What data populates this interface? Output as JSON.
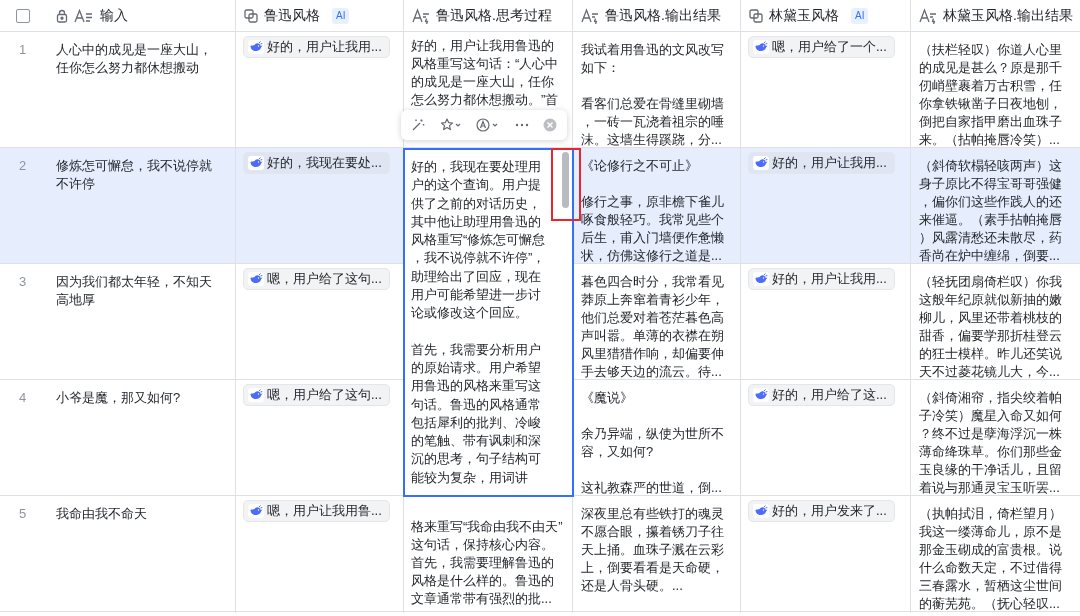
{
  "header_checkbox": {
    "checked": false
  },
  "columns": [
    {
      "kind": "text",
      "label": "输入"
    },
    {
      "kind": "ai",
      "label": "鲁迅风格",
      "badge": "AI"
    },
    {
      "kind": "derived",
      "label": "鲁迅风格.思考过程"
    },
    {
      "kind": "derived",
      "label": "鲁迅风格.输出结果"
    },
    {
      "kind": "ai",
      "label": "林黛玉风格",
      "badge": "AI"
    },
    {
      "kind": "derived",
      "label": "林黛玉风格.输出结果"
    }
  ],
  "rows": [
    {
      "number": "1",
      "selected": false,
      "thinking_editing": false,
      "input": "人心中的成见是一座大山，任你怎么努力都休想搬动",
      "luxun_chip": "好的，用户让我用...",
      "luxun_thinking": [
        "好的，用户让我用鲁迅的风格重写这句话：“人心中的成见是一座大山，任你怎么努力都休想搬动。”首"
      ],
      "luxun_output": [
        "我试着用鲁迅的文风改写如下：",
        "看客们总爱在骨缝里砌墙，一砖一瓦浇着祖宗的唾沫。这墙生得蹊跷，分..."
      ],
      "lin_chip": "嗯，用户给了一个...",
      "lin_output": "（扶栏轻叹）你道人心里的成见是甚么？原是那千仞峭壁裹着万古积雪，任你拿铁锹凿子日夜地刨，倒把自家指甲磨出血珠子来。（拈帕掩唇冷笑）..."
    },
    {
      "number": "2",
      "selected": true,
      "thinking_editing": true,
      "input": "修炼怎可懈怠，我不说停就不许停",
      "luxun_chip": "好的，我现在要处...",
      "luxun_thinking": [
        "好的，我现在要处理用户的这个查询。用户提供了之前的对话历史，其中他让助理用鲁迅的风格重写“修炼怎可懈怠，我不说停就不许停”，助理给出了回应，现在用户可能希望进一步讨论或修改这个回应。",
        "首先，我需要分析用户的原始请求。用户希望用鲁迅的风格来重写这句话。鲁迅的风格通常包括犀利的批判、冷峻的笔触、带有讽刺和深沉的思考，句子结构可能较为复杂，用词讲"
      ],
      "luxun_output": [
        "《论修行之不可止》",
        "修行之事，原非檐下雀儿啄食般轻巧。我常见些个后生，甫入门墙便作惫懒状，仿佛这修行之道是..."
      ],
      "lin_chip": "好的，用户让我用...",
      "lin_output": "（斜倚软榻轻咳两声）这身子原比不得宝哥哥强健，偏你们这些作践人的还来催逼。（素手拈帕掩唇）风露清愁还未散尽，药香尚在炉中缠绵，倒要..."
    },
    {
      "number": "3",
      "selected": false,
      "thinking_editing": false,
      "input": "因为我们都太年轻，不知天高地厚",
      "luxun_chip": "嗯，用户给了这句...",
      "luxun_output": [
        "暮色四合时分，我常看见莽原上奔窜着青衫少年，他们总爱对着苍茫暮色高声叫嚣。单薄的衣襟在朔风里猎猎作响，却偏要伸手去够天边的流云。待..."
      ],
      "lin_chip": "好的，用户让我用...",
      "lin_output": "（轻抚团扇倚栏叹）你我这般年纪原就似新抽的嫩柳儿，风里还带着桃枝的甜香，偏要学那折桂登云的狂士模样。昨儿还笑说天不过菱花镜儿大，今..."
    },
    {
      "number": "4",
      "selected": false,
      "thinking_editing": false,
      "input": "小爷是魔，那又如何?",
      "luxun_chip": "嗯，用户给了这句...",
      "luxun_output": [
        "《魔说》",
        "余乃异端，纵使为世所不容，又如何?",
        "这礼教森严的世道，倒..."
      ],
      "lin_chip": "好的，用户给了这...",
      "lin_output": "（斜倚湘帘，指尖绞着帕子冷笑）魔星入命又如何？终不过是孽海浮沉一株薄命绛珠草。你们那些金玉良缘的干净话儿，且留着说与那通灵宝玉听罢..."
    },
    {
      "number": "5",
      "selected": false,
      "thinking_editing": false,
      "input": "我命由我不命天",
      "luxun_chip": "嗯，用户让我用鲁...",
      "luxun_thinking": [
        "格来重写“我命由我不由天”这句话，保持核心内容。首先，我需要理解鲁迅的风格是什么样的。鲁迅的文章通常带有强烈的批..."
      ],
      "luxun_output": [
        "深夜里总有些铁打的魂灵不愿合眼，攥着锈刀子往天上捅。血珠子溅在云彩上，倒要看看是天命硬，还是人骨头硬。..."
      ],
      "lin_chip": "好的，用户发来了...",
      "lin_output": "（执帕拭泪，倚栏望月）我这一缕薄命儿，原不是那金玉砌成的富贵根。说什么命数天定，不过借得三春露水，暂栖这尘世间的蘅芜苑。（抚心轻叹..."
    }
  ]
}
